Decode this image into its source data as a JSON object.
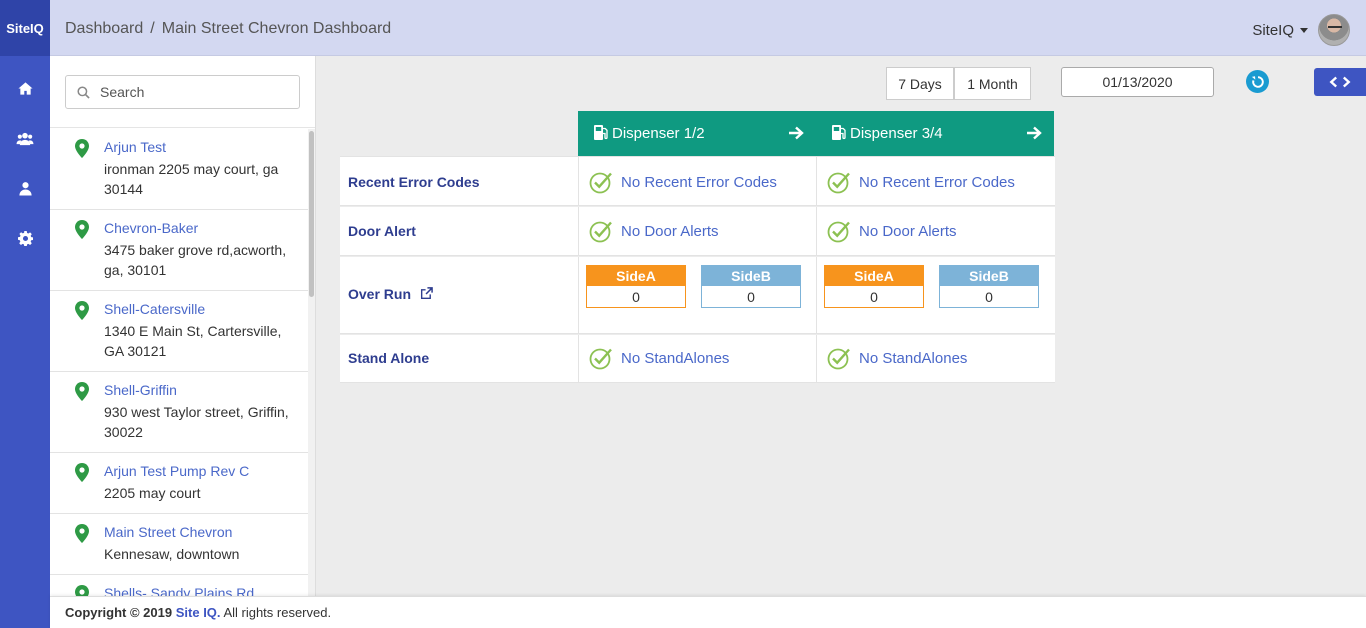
{
  "brand": "SiteIQ",
  "breadcrumb": {
    "root": "Dashboard",
    "separator": "/",
    "current": "Main Street Chevron Dashboard"
  },
  "user": {
    "name": "SiteIQ"
  },
  "nav_icons": [
    "home-icon",
    "users-icon",
    "user-icon",
    "gear-icon"
  ],
  "search": {
    "placeholder": "Search",
    "value": ""
  },
  "sites": [
    {
      "name": "Arjun Test",
      "address": "ironman 2205 may court, ga 30144"
    },
    {
      "name": "Chevron-Baker",
      "address": "3475 baker grove rd,acworth, ga, 30101"
    },
    {
      "name": "Shell-Catersville",
      "address": "1340 E Main St, Cartersville, GA 30121"
    },
    {
      "name": "Shell-Griffin",
      "address": "930 west Taylor street, Griffin, 30022"
    },
    {
      "name": "Arjun Test Pump Rev C",
      "address": "2205 may court"
    },
    {
      "name": "Main Street Chevron",
      "address": "Kennesaw, downtown"
    },
    {
      "name": "Shells- Sandy Plains Rd",
      "address": ""
    }
  ],
  "toolbar": {
    "range_7_days": "7 Days",
    "range_1_month": "1 Month",
    "date": "01/13/2020"
  },
  "dispensers": [
    {
      "title": "Dispenser 1/2",
      "recent_error_codes": "No Recent Error Codes",
      "door_alert": "No Door Alerts",
      "over_run": {
        "side_a_label": "SideA",
        "side_a_value": "0",
        "side_b_label": "SideB",
        "side_b_value": "0"
      },
      "stand_alone": "No StandAlones"
    },
    {
      "title": "Dispenser 3/4",
      "recent_error_codes": "No Recent Error Codes",
      "door_alert": "No Door Alerts",
      "over_run": {
        "side_a_label": "SideA",
        "side_a_value": "0",
        "side_b_label": "SideB",
        "side_b_value": "0"
      },
      "stand_alone": "No StandAlones"
    }
  ],
  "row_labels": {
    "recent_error_codes": "Recent Error Codes",
    "door_alert": "Door Alert",
    "over_run": "Over Run",
    "stand_alone": "Stand Alone"
  },
  "footer": {
    "prefix": "Copyright © 2019",
    "brand": "Site IQ.",
    "suffix": "All rights reserved."
  },
  "colors": {
    "rail": "#3e55c2",
    "header": "#d3d8f1",
    "dispenser_header": "#0f9a81",
    "side_a": "#f7941d",
    "side_b": "#7db3d8",
    "link": "#4a68c9",
    "check": "#8cc152"
  }
}
